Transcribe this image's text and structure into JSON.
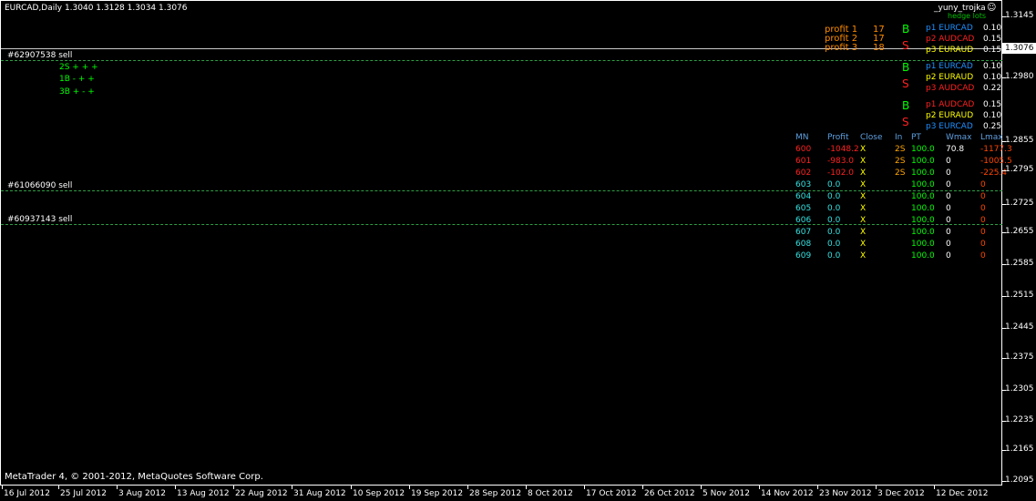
{
  "symbol_header": "EURCAD,Daily  1.3040 1.3128 1.3034 1.3076",
  "copyright": "MetaTrader 4, © 2001-2012, MetaQuotes Software Corp.",
  "indicator_name": "_yuny_trojka",
  "hedge_lots_label": "hedge lots",
  "current_price": "1.3076",
  "price_scale": [
    "1.3145",
    "1.2980",
    "1.2855",
    "1.2795",
    "1.2725",
    "1.2655",
    "1.2585",
    "1.2515",
    "1.2445",
    "1.2375",
    "1.2305",
    "1.2235",
    "1.2165",
    "1.2095"
  ],
  "date_scale": [
    "16 Jul 2012",
    "25 Jul 2012",
    "3 Aug 2012",
    "13 Aug 2012",
    "22 Aug 2012",
    "31 Aug 2012",
    "10 Sep 2012",
    "19 Sep 2012",
    "28 Sep 2012",
    "8 Oct 2012",
    "17 Oct 2012",
    "26 Oct 2012",
    "5 Nov 2012",
    "14 Nov 2012",
    "23 Nov 2012",
    "3 Dec 2012",
    "12 Dec 2012"
  ],
  "orders": [
    {
      "label": "#62907538 sell"
    },
    {
      "label": "#61066090 sell"
    },
    {
      "label": "#60937143 sell"
    }
  ],
  "signals": [
    "2S + + +",
    "1B - + +",
    "3B + - +"
  ],
  "profits": [
    {
      "label": "profit 1",
      "value": "17"
    },
    {
      "label": "profit 2",
      "value": "17"
    },
    {
      "label": "profit 3",
      "value": "18"
    }
  ],
  "groups": [
    {
      "dir": "B",
      "dir2": "S",
      "rows": [
        {
          "pair": "p1 EURCAD",
          "lot": "0.10",
          "color": "#1e90ff"
        },
        {
          "pair": "p2 AUDCAD",
          "lot": "0.15",
          "color": "#ff2020"
        },
        {
          "pair": "p3 EURAUD",
          "lot": "0.15",
          "color": "#ffff00"
        }
      ]
    },
    {
      "dir": "B",
      "dir2": "S",
      "rows": [
        {
          "pair": "p1 EURCAD",
          "lot": "0.10",
          "color": "#1e90ff"
        },
        {
          "pair": "p2 EURAUD",
          "lot": "0.10",
          "color": "#ffff00"
        },
        {
          "pair": "p3 AUDCAD",
          "lot": "0.22",
          "color": "#ff2020"
        }
      ]
    },
    {
      "dir": "B",
      "dir2": "S",
      "rows": [
        {
          "pair": "p1 AUDCAD",
          "lot": "0.15",
          "color": "#ff2020"
        },
        {
          "pair": "p2 EURAUD",
          "lot": "0.10",
          "color": "#ffff00"
        },
        {
          "pair": "p3 EURCAD",
          "lot": "0.25",
          "color": "#1e90ff"
        }
      ]
    }
  ],
  "table": {
    "headers": [
      "MN",
      "Profit",
      "Close",
      "In",
      "PT",
      "Wmax",
      "Lmax"
    ],
    "rows": [
      {
        "mn": "600",
        "profit": "-1048.2",
        "close": "X",
        "in": "2S",
        "pt": "100.0",
        "wmax": "70.8",
        "lmax": "-1177.3",
        "color": "#ff2020"
      },
      {
        "mn": "601",
        "profit": "-983.0",
        "close": "X",
        "in": "2S",
        "pt": "100.0",
        "wmax": "0",
        "lmax": "-1005.5",
        "color": "#ff2020"
      },
      {
        "mn": "602",
        "profit": "-102.0",
        "close": "X",
        "in": "2S",
        "pt": "100.0",
        "wmax": "0",
        "lmax": "-225.4",
        "color": "#ff2020"
      },
      {
        "mn": "603",
        "profit": "0.0",
        "close": "X",
        "in": "",
        "pt": "100.0",
        "wmax": "0",
        "lmax": "0",
        "color": "#33e0e0"
      },
      {
        "mn": "604",
        "profit": "0.0",
        "close": "X",
        "in": "",
        "pt": "100.0",
        "wmax": "0",
        "lmax": "0",
        "color": "#33e0e0"
      },
      {
        "mn": "605",
        "profit": "0.0",
        "close": "X",
        "in": "",
        "pt": "100.0",
        "wmax": "0",
        "lmax": "0",
        "color": "#33e0e0"
      },
      {
        "mn": "606",
        "profit": "0.0",
        "close": "X",
        "in": "",
        "pt": "100.0",
        "wmax": "0",
        "lmax": "0",
        "color": "#33e0e0"
      },
      {
        "mn": "607",
        "profit": "0.0",
        "close": "X",
        "in": "",
        "pt": "100.0",
        "wmax": "0",
        "lmax": "0",
        "color": "#33e0e0"
      },
      {
        "mn": "608",
        "profit": "0.0",
        "close": "X",
        "in": "",
        "pt": "100.0",
        "wmax": "0",
        "lmax": "0",
        "color": "#33e0e0"
      },
      {
        "mn": "609",
        "profit": "0.0",
        "close": "X",
        "in": "",
        "pt": "100.0",
        "wmax": "0",
        "lmax": "0",
        "color": "#33e0e0"
      }
    ]
  },
  "colors": {
    "profit_label": "#ff8c00",
    "pt_value": "#00ff00",
    "in_value": "#ffa500",
    "lmax_neg": "#ff4500",
    "close_x": "#ffff00",
    "header": "#5fa0e0",
    "signal": "#00ff00",
    "buy": "#00ff00",
    "sell": "#ff2020"
  }
}
